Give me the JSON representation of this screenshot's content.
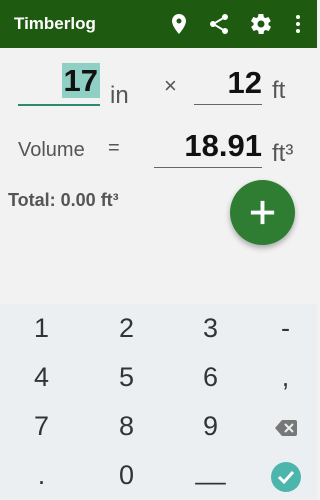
{
  "app_title": "Timberlog",
  "icons": {
    "location": "location-pin-icon",
    "share": "share-icon",
    "settings": "gear-icon",
    "menu": "more-vert-icon"
  },
  "inputs": {
    "diameter_value": "17",
    "diameter_unit": "in",
    "times_symbol": "×",
    "length_value": "12",
    "length_unit": "ft"
  },
  "volume": {
    "label": "Volume",
    "equals": "=",
    "value": "18.91",
    "unit": "ft³"
  },
  "total": "Total: 0.00 ft³",
  "keypad": {
    "row1": [
      "1",
      "2",
      "3",
      "-"
    ],
    "row2": [
      "4",
      "5",
      "6",
      ","
    ],
    "row3": [
      "7",
      "8",
      "9"
    ],
    "row4": [
      ".",
      "0",
      "__"
    ]
  },
  "colors": {
    "appbar": "#1f5a11",
    "accent": "#2e7d32",
    "selection": "#8fcfc4",
    "confirm": "#4db6ac"
  }
}
